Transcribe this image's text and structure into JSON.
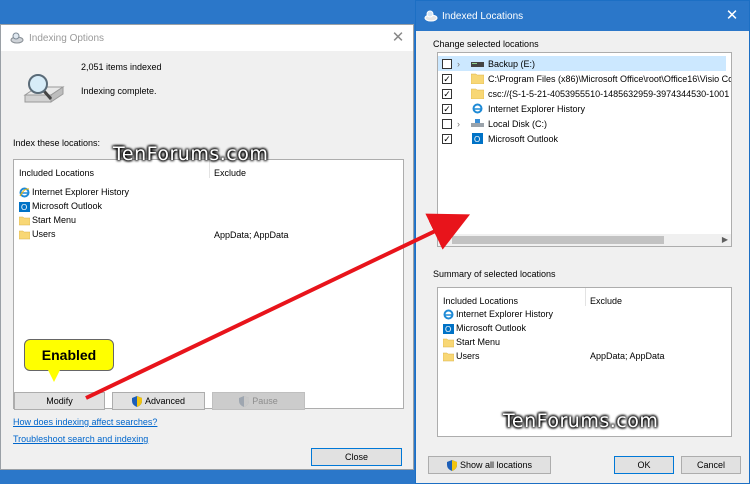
{
  "indexing_options": {
    "title": "Indexing Options",
    "items_indexed": "2,051 items indexed",
    "status": "Indexing complete.",
    "index_label": "Index these locations:",
    "columns": {
      "included": "Included Locations",
      "exclude": "Exclude"
    },
    "locations": [
      {
        "name": "Internet Explorer History",
        "icon": "ie-icon"
      },
      {
        "name": "Microsoft Outlook",
        "icon": "outlook-icon"
      },
      {
        "name": "Start Menu",
        "icon": "folder-icon"
      },
      {
        "name": "Users",
        "icon": "folder-icon",
        "exclude": "AppData; AppData"
      }
    ],
    "buttons": {
      "modify": "Modify",
      "advanced": "Advanced",
      "pause": "Pause",
      "close": "Close"
    },
    "links": {
      "how": "How does indexing affect searches?",
      "troubleshoot": "Troubleshoot search and indexing"
    }
  },
  "indexed_locations": {
    "title": "Indexed Locations",
    "change_label": "Change selected locations",
    "tree": [
      {
        "name": "Backup (E:)",
        "checked": false,
        "expander": true,
        "icon": "drive-icon",
        "selected": true
      },
      {
        "name": "C:\\Program Files (x86)\\Microsoft Office\\root\\Office16\\Visio Co",
        "checked": true,
        "icon": "folder-icon"
      },
      {
        "name": "csc://{S-1-5-21-4053955510-1485632959-3974344530-1001",
        "checked": true,
        "icon": "folder-icon"
      },
      {
        "name": "Internet Explorer History",
        "checked": true,
        "icon": "ie-icon"
      },
      {
        "name": "Local Disk (C:)",
        "checked": false,
        "expander": true,
        "icon": "drive-icon"
      },
      {
        "name": "Microsoft Outlook",
        "checked": true,
        "icon": "outlook-icon"
      }
    ],
    "summary_label": "Summary of selected locations",
    "columns": {
      "included": "Included Locations",
      "exclude": "Exclude"
    },
    "summary": [
      {
        "name": "Internet Explorer History",
        "icon": "ie-icon"
      },
      {
        "name": "Microsoft Outlook",
        "icon": "outlook-icon"
      },
      {
        "name": "Start Menu",
        "icon": "folder-icon"
      },
      {
        "name": "Users",
        "icon": "folder-icon",
        "exclude": "AppData; AppData"
      }
    ],
    "buttons": {
      "show_all": "Show all locations",
      "ok": "OK",
      "cancel": "Cancel"
    }
  },
  "annotation": {
    "callout": "Enabled",
    "watermark": "TenForums.com"
  },
  "colors": {
    "desktop": "#2b77c9",
    "arrow": "#e8141b",
    "callout": "#ffff00",
    "link": "#0066cc"
  }
}
